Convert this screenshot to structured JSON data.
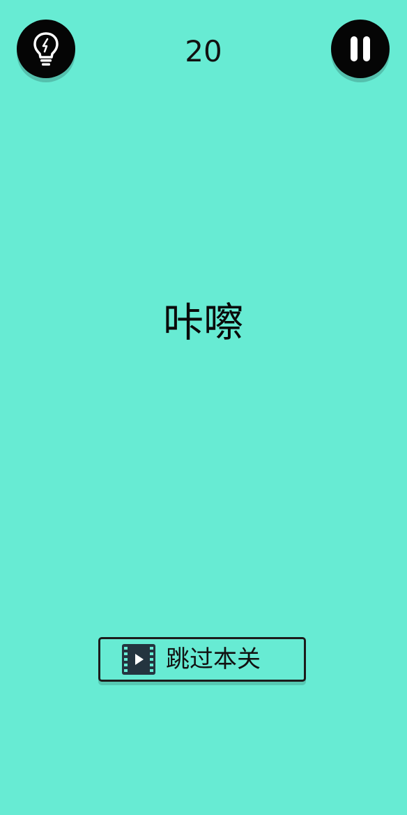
{
  "header": {
    "score": "20",
    "hint_icon": "lightbulb-icon",
    "pause_icon": "pause-icon"
  },
  "main": {
    "word": "咔嚓"
  },
  "footer": {
    "skip_label": "跳过本关",
    "skip_icon": "video-play-icon"
  },
  "colors": {
    "background": "#67ebd3",
    "button_dark": "#050505",
    "text": "#111111"
  }
}
